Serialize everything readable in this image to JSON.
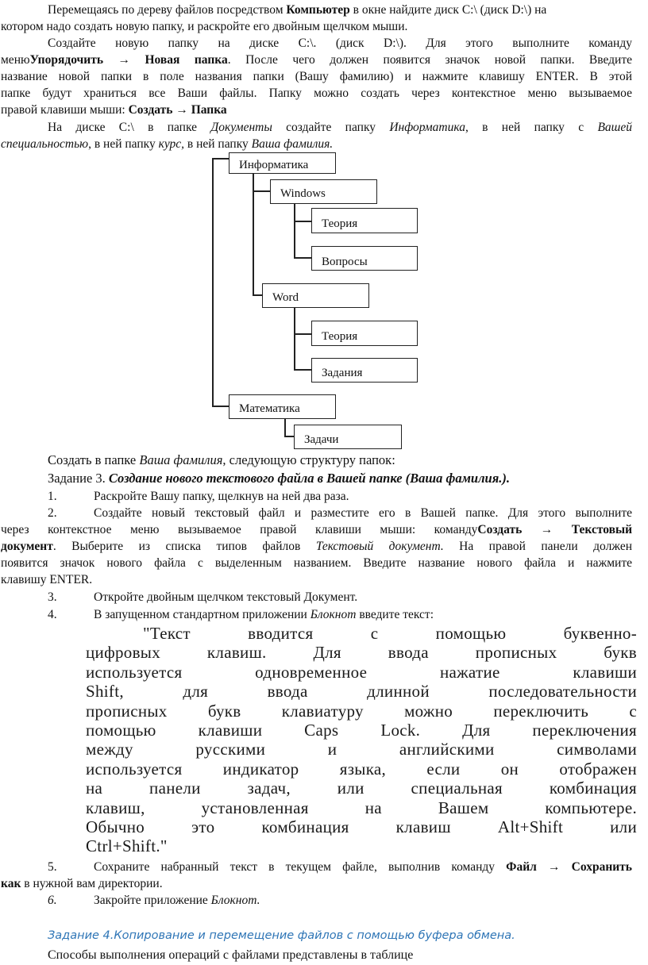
{
  "intro": {
    "p1_l1_a": "Перемещаясь по дереву файлов посредством ",
    "p1_l1_b": "Компьютер",
    "p1_l1_c": " в окне найдите диск C:\\ (диск D:\\) на",
    "p1_l2": "котором надо создать новую папку, и раскройте его двойным щелчком мыши.",
    "p2_l1": "Создайте новую папку на диске C:\\. (диск D:\\). Для этого выполните команду",
    "p2_l2_a": "меню",
    "p2_l2_b": "Упорядочить → Новая папка",
    "p2_l2_c": ". После чего должен появится значок новой папки. Введите",
    "p2_l3": "название новой папки в поле названия папки (Вашу фамилию) и нажмите клавишу ENTER. В этой",
    "p2_l4": "папке будут храниться все Ваши файлы. Папку можно создать через контекстное меню вызываемое",
    "p2_l5_a": "правой клавиши мыши: ",
    "p2_l5_b": "Создать → Папка",
    "p3_l1_a": "На диске C:\\ в папке ",
    "p3_l1_b": "Документы",
    "p3_l1_c": " создайте папку ",
    "p3_l1_d": "Информатика",
    "p3_l1_e": ", в ней папку с ",
    "p3_l1_f": "Вашей",
    "p3_l2_a": "специальностью",
    "p3_l2_b": ", в ней папку ",
    "p3_l2_c": "курс,",
    "p3_l2_d": " в ней папку ",
    "p3_l2_e": "Ваша фамилия."
  },
  "tree": {
    "nodes": [
      {
        "label": "Информатика"
      },
      {
        "label": "Windows"
      },
      {
        "label": "Теория"
      },
      {
        "label": "Вопросы"
      },
      {
        "label": "Word"
      },
      {
        "label": "Теория"
      },
      {
        "label": "Задания"
      },
      {
        "label": "Математика"
      },
      {
        "label": "Задачи"
      }
    ]
  },
  "task3": {
    "structure_a": "Создать в папке ",
    "structure_b": "Ваша фамилия",
    "structure_c": ", следующую структуру папок:",
    "heading_a": "Задание 3. ",
    "heading_b": "Создание нового текстового файла в Вашей папке (Ваша фамилия.).",
    "step1_num": "1.",
    "step1": "Раскройте Вашу папку, щелкнув на ней два раза.",
    "step2_num": "2.",
    "step2_l1": "Создайте новый текстовый файл и разместите его в Вашей папке. Для этого выполните",
    "step2_l2_a": "через контекстное меню вызываемое правой клавиши мыши: команду",
    "step2_l2_b": "Создать → Текстовый",
    "step2_l3_a": "документ",
    "step2_l3_b": ". Выберите из списка типов файлов ",
    "step2_l3_c": "Текстовый документ.",
    "step2_l3_d": " На правой панели должен",
    "step2_l4": "появится значок нового файла с выделенным названием. Введите название нового файла и нажмите",
    "step2_l5": "клавишу ENTER.",
    "step3_num": "3.",
    "step3": "Откройте двойным щелчком текстовый Документ.",
    "step4_num": "4.",
    "step4_a": "В запущенном стандартном приложении ",
    "step4_b": "Блокнот",
    "step4_c": " введите текст:",
    "quote_lines": [
      "\"Текст вводится с помощью буквенно-",
      "цифровых клавиш. Для ввода прописных букв",
      "используется одновременное нажатие клавиши",
      "Shift, для ввода длинной последовательности",
      "прописных букв клавиатуру можно переключить с",
      "помощью клавиши Caps Lock. Для переключения",
      "между русскими и английскими символами",
      "используется индикатор языка, если он отображен",
      "на панели задач, или специальная комбинация",
      "клавиш, установленная на Вашем компьютере.",
      "Обычно это комбинация клавиш Alt+Shift или",
      "Ctrl+Shift.\""
    ],
    "step5_num": "5.",
    "step5_l1_a": "Сохраните набранный текст в текущем файле, выполнив команду ",
    "step5_l1_b": "Файл → Сохранить",
    "step5_l2_a": "как",
    "step5_l2_b": " в нужной вам директории.",
    "step6_num": "6.",
    "step6_a": "Закройте приложение ",
    "step6_b": "Блокнот."
  },
  "task4": {
    "heading": "Задание 4.Копирование и перемещение файлов с помощью буфера обмена.",
    "text": "Способы выполнения операций с файлами представлены в таблице",
    "heading_color": "#2e75b6"
  }
}
